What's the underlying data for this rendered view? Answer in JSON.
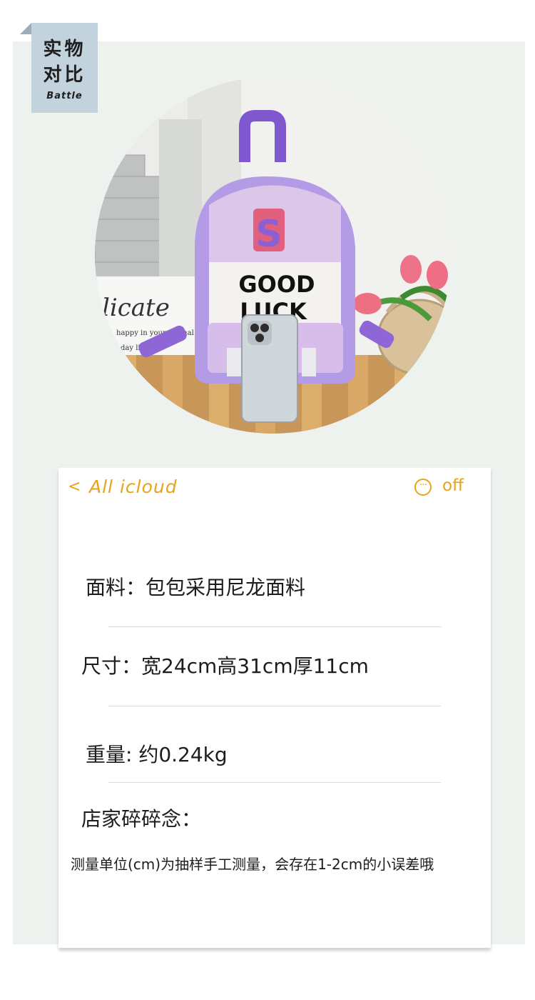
{
  "badge": {
    "line1": "实物",
    "line2": "对比",
    "line3": "Battle"
  },
  "photo": {
    "patch_letter": "S",
    "bag_text_line1": "GOOD",
    "bag_text_line2": "LUCK",
    "sign_text_line1": "licate",
    "sign_text_line2": "happy in your normal",
    "sign_text_line3": "day life"
  },
  "card": {
    "nav": {
      "back_label": "<",
      "title": "All icloud",
      "more_icon": "ellipsis-circle-icon",
      "off_label": "off"
    },
    "rows": [
      "面料：包包采用尼龙面料",
      "尺寸：宽24cm高31cm厚11cm",
      "重量:  约0.24kg",
      "店家碎碎念："
    ],
    "note": "测量单位(cm)为抽样手工测量，会存在1-2cm的小误差哦"
  },
  "colors": {
    "accent": "#e7a31a",
    "panel": "#eef2ef",
    "badge": "#c3d3dd",
    "bag_purple": "#b49be6"
  }
}
